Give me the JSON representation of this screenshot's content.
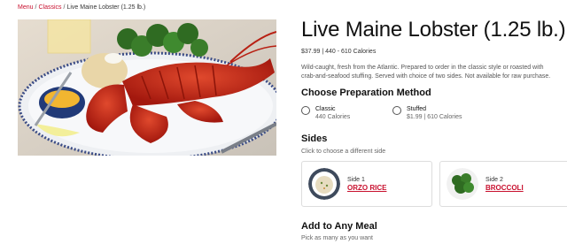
{
  "breadcrumb": {
    "items": [
      {
        "label": "Menu",
        "link": true
      },
      {
        "label": "Classics",
        "link": true
      },
      {
        "label": "Live Maine Lobster (1.25 lb.)",
        "link": false
      }
    ],
    "separator": "/"
  },
  "product": {
    "title": "Live Maine Lobster (1.25 lb.)",
    "meta": "$37.99 | 440 - 610 Calories",
    "description": "Wild-caught, fresh from the Atlantic. Prepared to order in the classic style or roasted with crab-and-seafood stuffing. Served with choice of two sides. Not available for raw purchase."
  },
  "preparation": {
    "heading": "Choose Preparation Method",
    "options": [
      {
        "label": "Classic",
        "detail": "440 Calories",
        "selected": false
      },
      {
        "label": "Stuffed",
        "detail": "$1.99 | 610 Calories",
        "selected": false
      }
    ]
  },
  "sides": {
    "heading": "Sides",
    "subtitle": "Click to choose a different side",
    "items": [
      {
        "slot": "Side 1",
        "name": "ORZO RICE"
      },
      {
        "slot": "Side 2",
        "name": "BROCCOLI"
      }
    ]
  },
  "add_meal": {
    "heading": "Add to Any Meal",
    "subtitle": "Pick as many as you want"
  },
  "colors": {
    "accent": "#c8102e",
    "text": "#111111",
    "muted": "#666666"
  }
}
